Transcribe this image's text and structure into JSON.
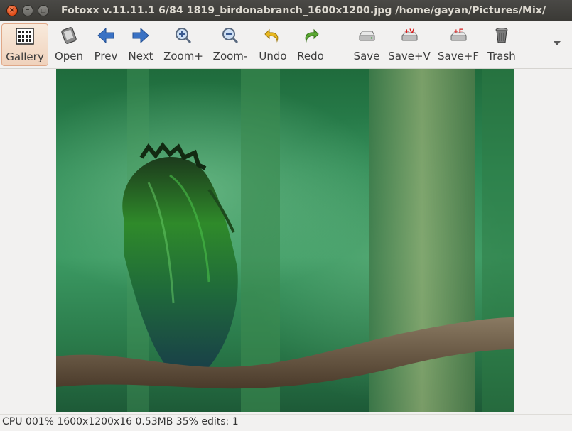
{
  "window": {
    "title": "Fotoxx v.11.11.1   6/84  1819_birdonabranch_1600x1200.jpg  /home/gayan/Pictures/Mix/",
    "close_glyph": "×",
    "minimize_glyph": "–",
    "maximize_glyph": "□"
  },
  "toolbar": {
    "items": [
      {
        "label": "Gallery",
        "icon": "gallery-icon",
        "active": true
      },
      {
        "label": "Open",
        "icon": "open-icon"
      },
      {
        "label": "Prev",
        "icon": "left-arrow-icon",
        "color": "#3a72c4"
      },
      {
        "label": "Next",
        "icon": "right-arrow-icon",
        "color": "#3a72c4"
      },
      {
        "label": "Zoom+",
        "icon": "zoom-in-icon"
      },
      {
        "label": "Zoom-",
        "icon": "zoom-out-icon"
      },
      {
        "label": "Undo",
        "icon": "undo-icon",
        "color": "#e8b820"
      },
      {
        "label": "Redo",
        "icon": "redo-icon",
        "color": "#5aa832"
      },
      {
        "label": "Save",
        "icon": "save-icon"
      },
      {
        "label": "Save+V",
        "icon": "save-version-icon",
        "badge": "+V",
        "color": "#d42020"
      },
      {
        "label": "Save+F",
        "icon": "save-file-icon",
        "badge": "+F",
        "color": "#d42020"
      },
      {
        "label": "Trash",
        "icon": "trash-icon"
      }
    ],
    "overflow_icon": "chevron-down-icon"
  },
  "image": {
    "description_icon": "bird-on-branch-photo"
  },
  "status": {
    "text": "CPU 001%  1600x1200x16 0.53MB 35%  edits: 1"
  }
}
